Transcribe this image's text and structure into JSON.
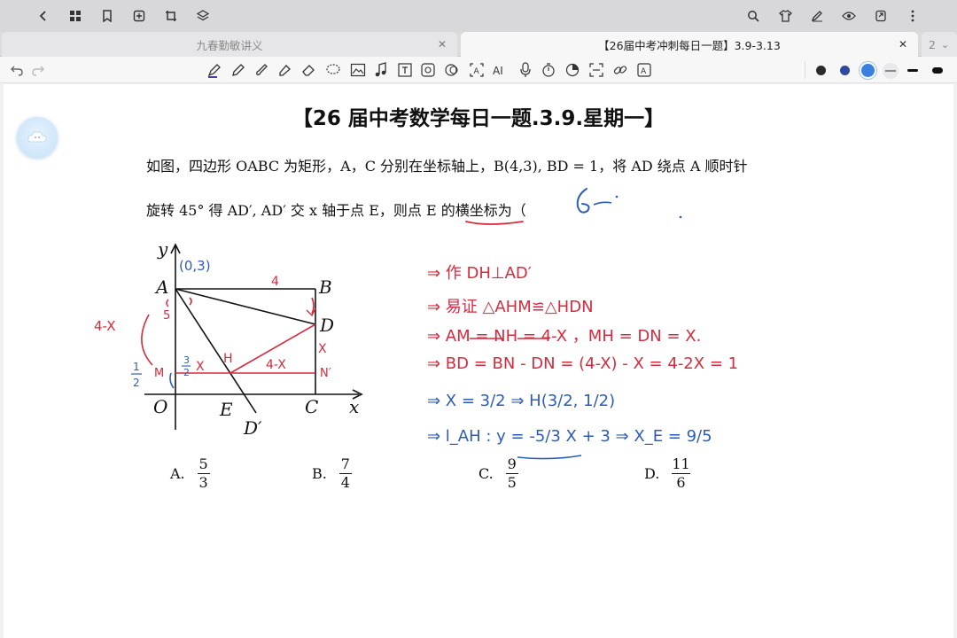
{
  "tabs": [
    {
      "label": "九春勤敏讲义",
      "active": false
    },
    {
      "label": "【26届中考冲刺每日一题】3.9-3.13",
      "active": true
    },
    {
      "label": "2",
      "active": false
    }
  ],
  "pen_colors": [
    "#2b2b2b",
    "#2f4a9c",
    "#3b7fe0"
  ],
  "title": "【26 届中考数学每日一题.3.9.星期一】",
  "question": {
    "line1": "如图，四边形 OABC 为矩形，A，C 分别在坐标轴上，B(4,3), BD = 1，将 AD 绕点 A 顺时针",
    "line2": "旋转 45° 得 AD′, AD′ 交 x 轴于点 E，则点 E 的横坐标为（"
  },
  "choices": [
    {
      "letter": "A.",
      "num": "5",
      "den": "3"
    },
    {
      "letter": "B.",
      "num": "7",
      "den": "4"
    },
    {
      "letter": "C.",
      "num": "9",
      "den": "5"
    },
    {
      "letter": "D.",
      "num": "11",
      "den": "6"
    }
  ],
  "figure": {
    "labels": {
      "y": "y",
      "x": "x",
      "O": "O",
      "A": "A",
      "B": "B",
      "C": "C",
      "D": "D",
      "E": "E",
      "Dp": "D′"
    },
    "handwriting": {
      "coord_A": "(0,3)",
      "top_len": "4",
      "left_len": "4-X",
      "left_frac_top": "1",
      "left_frac_bot": "2",
      "M": "M",
      "H": "H",
      "Nprime": "N′",
      "frac_3_2": "3",
      "frac_3_2_bot": "2",
      "x_label": "X",
      "mid_len": "4-X",
      "side_x": "X",
      "left5": "5",
      "answer": "6 ."
    }
  },
  "solution_steps": [
    "⇒ 作 DH⊥AD′",
    "⇒ 易证 △AHM≌△HDN",
    "⇒ AM = NH = 4-X ，MH = DN = X.",
    "⇒ BD = BN - DN = (4-X) - X = 4-2X = 1",
    "⇒ X = 3/2  ⇒ H(3/2, 1/2)",
    "⇒ l_AH : y = -5/3 X + 3  ⇒ X_E = 9/5"
  ]
}
